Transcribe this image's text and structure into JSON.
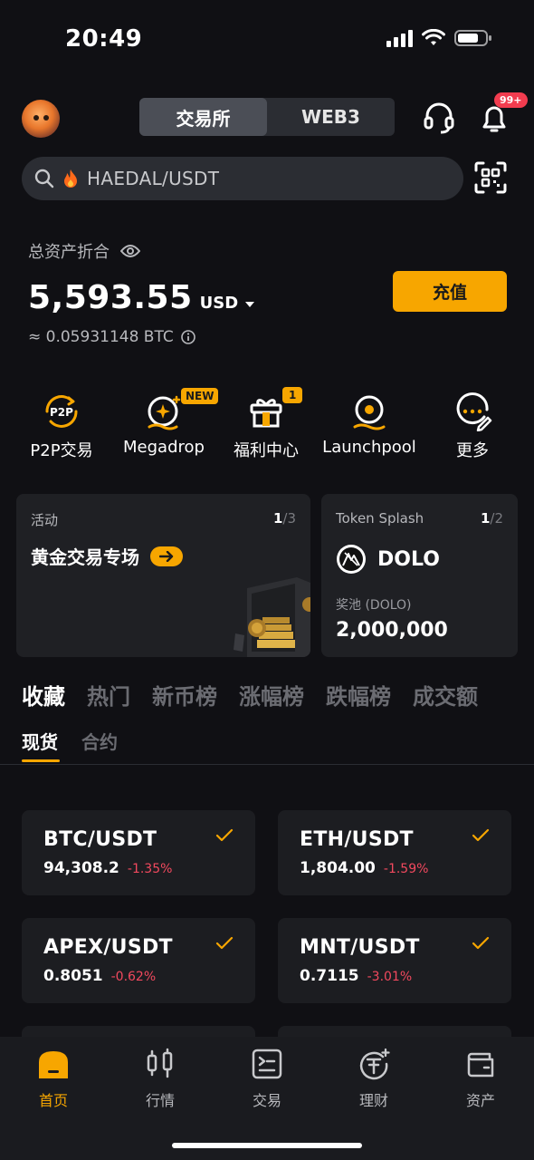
{
  "status_bar": {
    "time": "20:49"
  },
  "header": {
    "tabs": [
      {
        "label": "交易所",
        "active": true
      },
      {
        "label": "WEB3",
        "active": false
      }
    ],
    "notification_badge": "99+"
  },
  "search": {
    "query": "HAEDAL/USDT"
  },
  "assets": {
    "label": "总资产折合",
    "value": "5,593.55",
    "currency": "USD",
    "btc_equivalent": "≈ 0.05931148 BTC",
    "deposit_label": "充值"
  },
  "quick_entries": [
    {
      "label": "P2P交易",
      "icon": "p2p-icon"
    },
    {
      "label": "Megadrop",
      "icon": "megadrop-icon",
      "tag": "NEW"
    },
    {
      "label": "福利中心",
      "icon": "gift-icon",
      "tag": "1"
    },
    {
      "label": "Launchpool",
      "icon": "launchpool-icon"
    },
    {
      "label": "更多",
      "icon": "more-icon"
    }
  ],
  "promo_cards": {
    "activity": {
      "title": "活动",
      "page_current": "1",
      "page_total": "/3",
      "headline": "黄金交易专场"
    },
    "token_splash": {
      "title": "Token Splash",
      "page_current": "1",
      "page_total": "/2",
      "token": "DOLO",
      "pool_label": "奖池 (DOLO)",
      "pool_value": "2,000,000"
    }
  },
  "market_tabs": [
    "收藏",
    "热门",
    "新币榜",
    "涨幅榜",
    "跌幅榜",
    "成交额"
  ],
  "sub_tabs": [
    "现货",
    "合约"
  ],
  "favorites": [
    {
      "pair": "BTC/USDT",
      "price": "94,308.2",
      "change": "-1.35%"
    },
    {
      "pair": "ETH/USDT",
      "price": "1,804.00",
      "change": "-1.59%"
    },
    {
      "pair": "APEX/USDT",
      "price": "0.8051",
      "change": "-0.62%"
    },
    {
      "pair": "MNT/USDT",
      "price": "0.7115",
      "change": "-3.01%"
    }
  ],
  "bottom_nav": [
    {
      "label": "首页",
      "active": true
    },
    {
      "label": "行情",
      "active": false
    },
    {
      "label": "交易",
      "active": false
    },
    {
      "label": "理财",
      "active": false
    },
    {
      "label": "资产",
      "active": false
    }
  ],
  "colors": {
    "accent": "#f7a600",
    "negative": "#f2495e",
    "background": "#101014",
    "card": "#1f2024"
  }
}
